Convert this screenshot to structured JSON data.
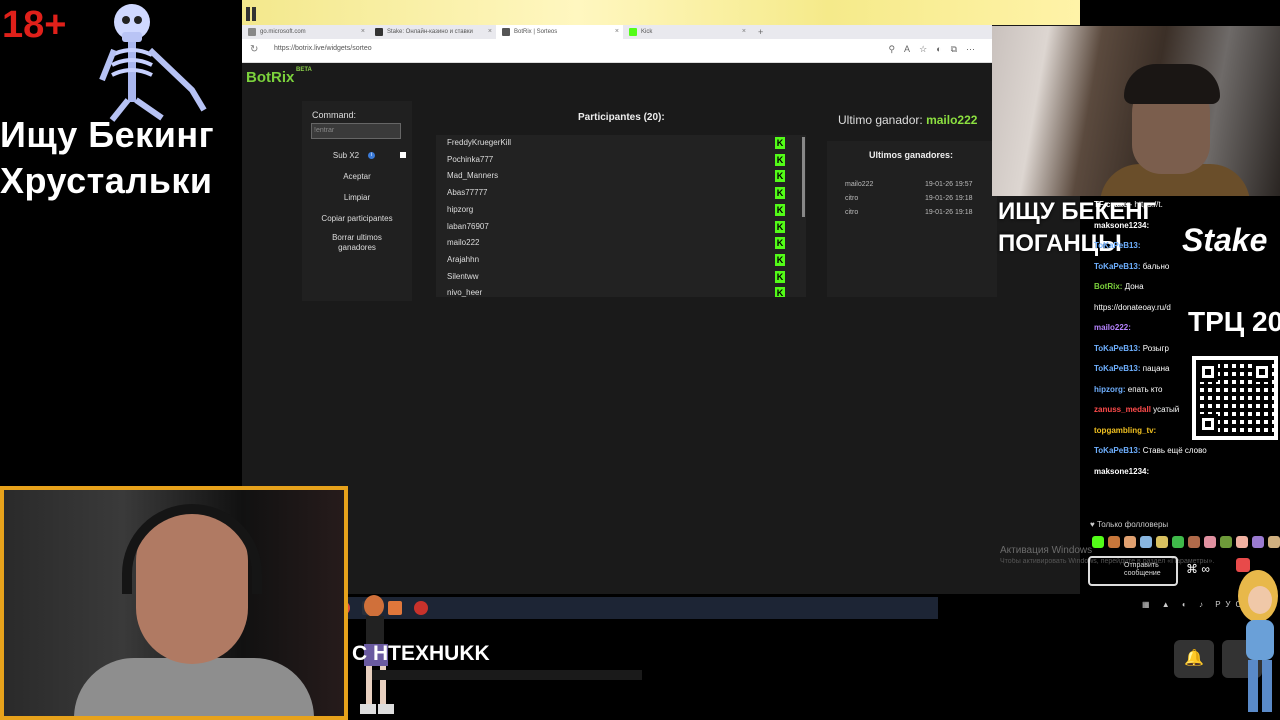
{
  "overlay": {
    "age_badge": "18+",
    "left_title_line1": "Ищу Бекинг",
    "left_title_line2": "Хрустальки",
    "right_title_line1": "ИЩУ БЕКЕНГ",
    "right_title_line2": "ПОГАНЦЫ",
    "stake_logo": "Stake",
    "trc_text": "ТРЦ 20",
    "bottom_name": "C   HTEXHUKK"
  },
  "browser": {
    "tabs": [
      {
        "label": "go.microsoft.com",
        "active": false
      },
      {
        "label": "Stake: Онлайн-казино и ставки",
        "active": false
      },
      {
        "label": "BotRix | Sorteos",
        "active": true
      },
      {
        "label": "Kick",
        "active": false
      }
    ],
    "new_tab": "+",
    "url": "https://botrix.live/widgets/sorteo"
  },
  "botrix": {
    "logo": "BotRix",
    "beta": "BETA",
    "command_label": "Command:",
    "command_placeholder": "!entrar",
    "sub_x2": "Sub X2",
    "info": "i",
    "buttons": {
      "aceptar": "Aceptar",
      "limpiar": "Limpiar",
      "copiar": "Copiar participantes",
      "borrar": "Borrar ultimos ganadores"
    },
    "participants_title": "Participantes (20):",
    "participants": [
      "FreddyKruegerKill",
      "Pochinka777",
      "Mad_Manners",
      "Abas77777",
      "hipzorg",
      "laban76907",
      "mailo222",
      "Arajahhn",
      "Silentww",
      "nivo_heer"
    ],
    "kick_icon": "K",
    "last_winner_label": "Ultimo ganador:",
    "last_winner": "mailo222",
    "winners_title": "Ultimos ganadores:",
    "winners": [
      {
        "name": "mailo222",
        "date": "19-01-26 19:57"
      },
      {
        "name": "citro",
        "date": "19-01-26 19:18"
      },
      {
        "name": "citro",
        "date": "19-01-26 19:18"
      }
    ]
  },
  "windows": {
    "activation_title": "Активация Windows",
    "activation_sub": "Чтобы активировать Windows, перейдите в раздел «Параметры»."
  },
  "chat": {
    "messages": [
      {
        "user": "TF стаке",
        "text": "- https://t.",
        "color": "#ffffff"
      },
      {
        "user": "maksone1234:",
        "text": "",
        "color": "#ffffff"
      },
      {
        "user": "ToKaPeB13:",
        "text": "",
        "color": "#6fb0ff"
      },
      {
        "user": "ToKaPeB13:",
        "text": "бально",
        "color": "#6fb0ff"
      },
      {
        "user": "BotRix:",
        "text": "Дона",
        "color": "#7bd13c"
      },
      {
        "user": "",
        "text": "https://donateoay.ru/d",
        "color": "#ffffff"
      },
      {
        "user": "mailo222:",
        "text": "",
        "color": "#b784ff"
      },
      {
        "user": "ToKaPeB13:",
        "text": "Розыгр",
        "color": "#6fb0ff"
      },
      {
        "user": "ToKaPeB13:",
        "text": "пацана",
        "color": "#6fb0ff"
      },
      {
        "user": "hipzorg:",
        "text": "епать кто",
        "color": "#6fb0ff"
      },
      {
        "user": "zanuss_medall",
        "text": "усатый",
        "color": "#ff4b4b"
      },
      {
        "user": "topgambling_tv:",
        "text": "",
        "color": "#f0c020"
      },
      {
        "user": "ToKaPeB13:",
        "text": "Ставь ещё слово",
        "color": "#6fb0ff"
      },
      {
        "user": "maksone1234:",
        "text": "",
        "color": "#ffffff"
      }
    ],
    "followers_only": "♥ Только фолловеры",
    "send_label": "Отправить сообщение",
    "more": "⌘ ∞"
  },
  "colors": {
    "botrix_green": "#7bd13c",
    "kick_green": "#53fc18",
    "cam_border": "#e7a21b",
    "age_red": "#e0201a"
  },
  "icons": {
    "bell": "🔔"
  }
}
